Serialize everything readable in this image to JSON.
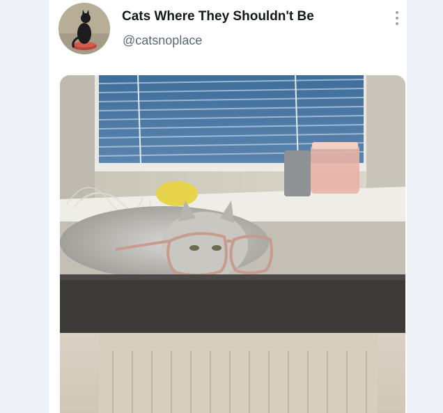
{
  "post": {
    "display_name": "Cats Where They Shouldn't Be",
    "handle": "@catsnoplace"
  },
  "icons": {
    "more": "more-vertical-icon"
  }
}
